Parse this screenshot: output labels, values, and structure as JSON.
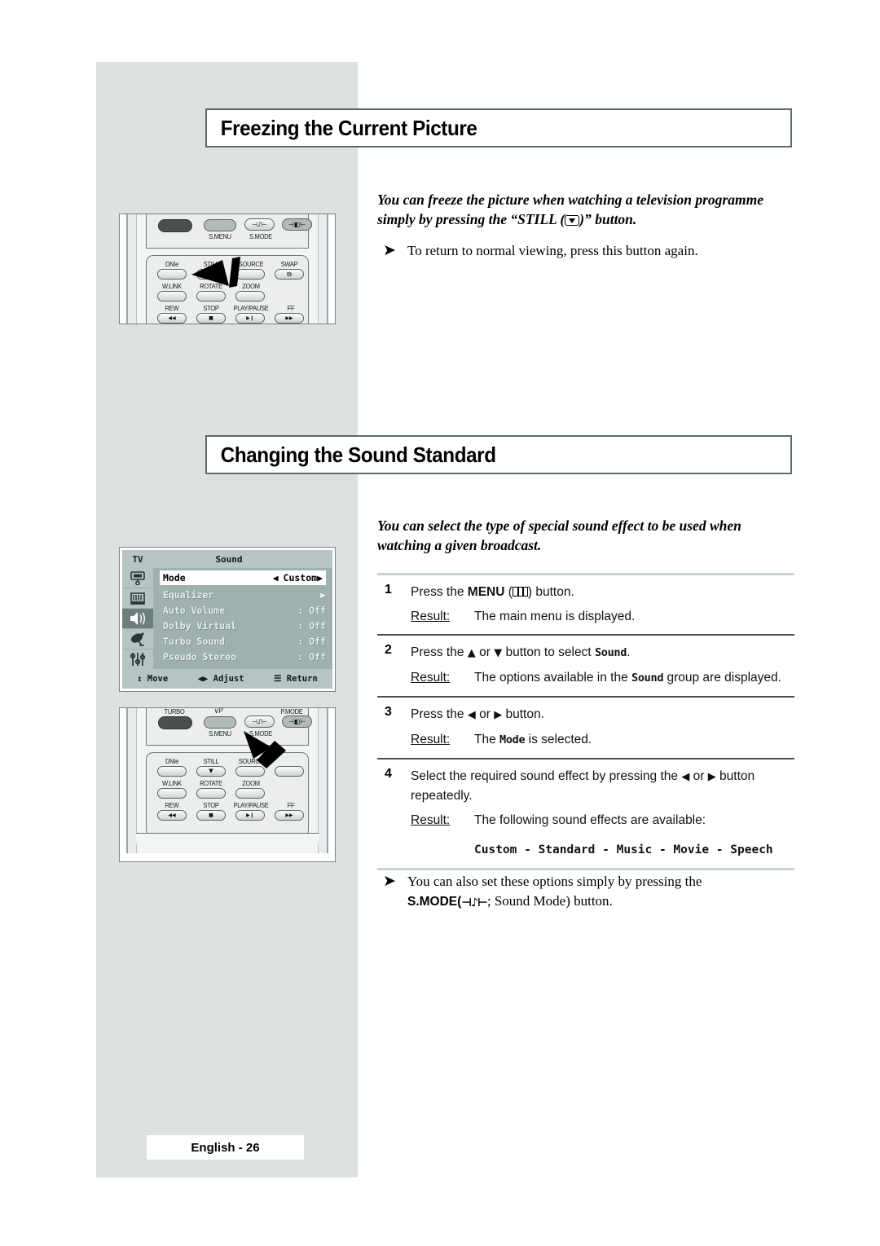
{
  "page": {
    "footer_label": "English - 26",
    "panel_color": "#dde2e1"
  },
  "sections": [
    {
      "heading": "Freezing the Current Picture",
      "intro_line1": "You can freeze the picture when watching a television programme",
      "intro_line2": "simply by pressing the “STILL (",
      "intro_line3": ")” button.",
      "note": "To return to normal viewing, press this button again."
    },
    {
      "heading": "Changing the Sound Standard",
      "intro_line1": "You can select the type of special sound effect to be used when",
      "intro_line2": "watching a given broadcast."
    }
  ],
  "steps": [
    {
      "num": "1",
      "text_before": "Press the ",
      "text_bold": "MENU",
      "text_mid": " (",
      "text_after": ") button.",
      "result_label": "Result:",
      "result_text": "The main menu is displayed."
    },
    {
      "num": "2",
      "text_before": "Press the ",
      "up": "▲",
      "or": " or ",
      "down": "▼",
      "text_after": " button to select ",
      "target": "Sound",
      "text_end": ".",
      "result_label": "Result:",
      "result_before": "The options available in the ",
      "result_target": "Sound",
      "result_after": " group are displayed."
    },
    {
      "num": "3",
      "text_before": "Press the ",
      "left": "◀",
      "or": " or ",
      "right": "▶",
      "text_after": " button.",
      "result_label": "Result:",
      "result_before": "The ",
      "result_target": "Mode",
      "result_after": " is selected."
    },
    {
      "num": "4",
      "text_before": "Select the required sound effect by pressing the ",
      "left": "◀",
      "or": " or ",
      "right": "▶",
      "text_after": " button repeatedly.",
      "result_label": "Result:",
      "result_text": "The following sound effects are available:",
      "effects": "Custom - Standard - Music - Movie - Speech"
    }
  ],
  "smode_note": {
    "line1": "You can also set these options simply by pressing the",
    "label": "S.MODE",
    "paren_open": "(",
    "glyph": "⊣♪⊢",
    "paren_rest": "; Sound Mode) button."
  },
  "osd": {
    "tv_label": "TV",
    "title": "Sound",
    "sidebar_icons": [
      "input-source-icon",
      "picture-icon",
      "sound-speaker-icon",
      "satellite-dish-icon",
      "setup-sliders-icon"
    ],
    "rows": [
      {
        "label": "Mode",
        "left_arrow": "◀",
        "value": "Custom",
        "right_arrow": "▶",
        "highlighted": true
      },
      {
        "label": "Equalizer",
        "value": "",
        "right_arrow": "▶",
        "highlighted": false
      },
      {
        "label": "Auto Volume",
        "value": ": Off",
        "highlighted": false
      },
      {
        "label": "Dolby Virtual",
        "value": ": Off",
        "highlighted": false
      },
      {
        "label": "Turbo Sound",
        "value": ": Off",
        "highlighted": false
      },
      {
        "label": "Pseudo Stereo",
        "value": ": Off",
        "highlighted": false
      }
    ],
    "footer": [
      {
        "glyph": "↕",
        "label": "Move"
      },
      {
        "glyph": "◀▶",
        "label": "Adjust"
      },
      {
        "glyph": "☰",
        "label": "Return"
      }
    ]
  },
  "remote_top": {
    "top_labels": [
      "S.MENU",
      "S.MODE"
    ],
    "row_labels": [
      "DNIe",
      "STILL",
      "SOURCE",
      "SWAP"
    ],
    "row2_labels": [
      "W.LINK",
      "ROTATE",
      "ZOOM"
    ],
    "row3_labels": [
      "REW",
      "STOP",
      "PLAY/PAUSE",
      "FF"
    ],
    "glyphs": {
      "smode": "⊣♪⊢",
      "pmode": "⊣◧⊢",
      "still": "▼",
      "swap": "⧉",
      "rew": "◀◀",
      "stop": "■",
      "play": "▶❙",
      "ff": "▶▶"
    }
  },
  "remote_bottom": {
    "top_labels": [
      "TURBO",
      "S.MENU",
      "S.MODE",
      "P.MODE"
    ],
    "vp_label": "∨P",
    "row_labels": [
      "DNIe",
      "STILL",
      "SOURCE",
      ""
    ],
    "row2_labels": [
      "W.LINK",
      "ROTATE",
      "ZOOM"
    ],
    "row3_labels": [
      "REW",
      "STOP",
      "PLAY/PAUSE",
      "FF"
    ]
  }
}
